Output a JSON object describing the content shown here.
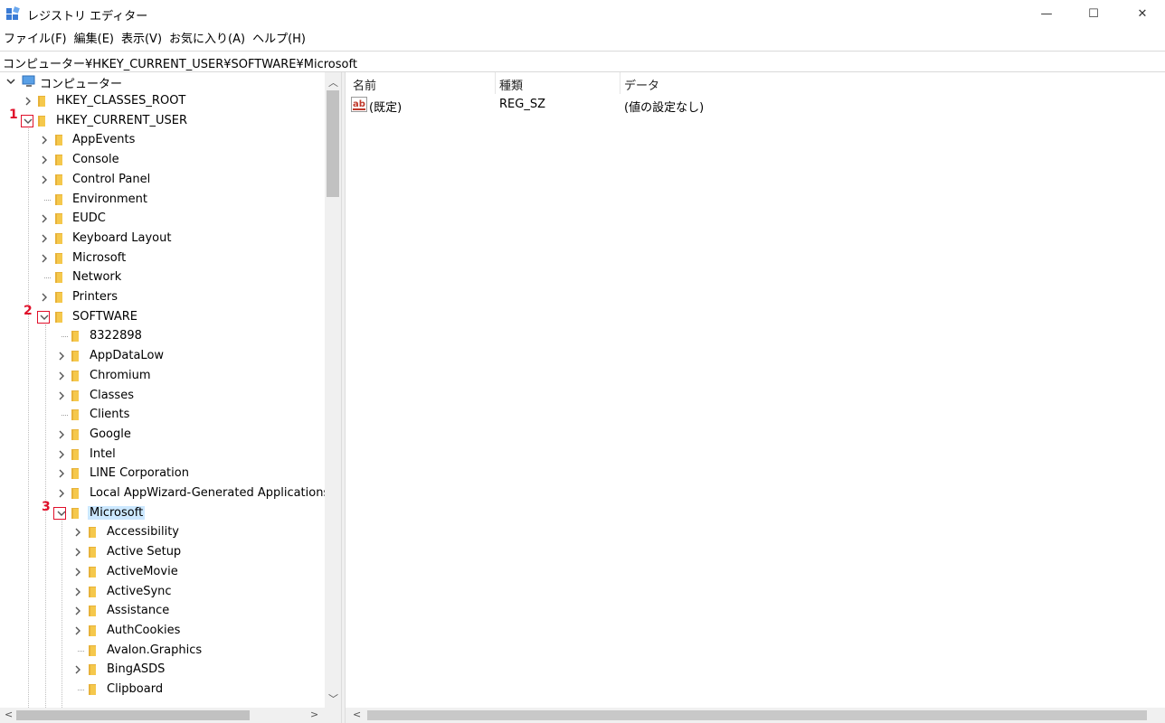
{
  "window": {
    "title": "レジストリ エディター",
    "controls": {
      "minimize": "—",
      "maximize": "☐",
      "close": "✕"
    }
  },
  "menu": [
    "ファイル(F)",
    "編集(E)",
    "表示(V)",
    "お気に入り(A)",
    "ヘルプ(H)"
  ],
  "address": "コンピューター¥HKEY_CURRENT_USER¥SOFTWARE¥Microsoft",
  "tree": {
    "root": "コンピューター",
    "items": [
      {
        "label": "HKEY_CLASSES_ROOT",
        "depth": 1,
        "state": "collapsed"
      },
      {
        "label": "HKEY_CURRENT_USER",
        "depth": 1,
        "state": "expanded",
        "marker": "1"
      },
      {
        "label": "AppEvents",
        "depth": 2,
        "state": "collapsed"
      },
      {
        "label": "Console",
        "depth": 2,
        "state": "collapsed"
      },
      {
        "label": "Control Panel",
        "depth": 2,
        "state": "collapsed"
      },
      {
        "label": "Environment",
        "depth": 2,
        "state": "leaf"
      },
      {
        "label": "EUDC",
        "depth": 2,
        "state": "collapsed"
      },
      {
        "label": "Keyboard Layout",
        "depth": 2,
        "state": "collapsed"
      },
      {
        "label": "Microsoft",
        "depth": 2,
        "state": "collapsed"
      },
      {
        "label": "Network",
        "depth": 2,
        "state": "leaf"
      },
      {
        "label": "Printers",
        "depth": 2,
        "state": "collapsed"
      },
      {
        "label": "SOFTWARE",
        "depth": 2,
        "state": "expanded",
        "marker": "2"
      },
      {
        "label": "8322898",
        "depth": 3,
        "state": "leaf"
      },
      {
        "label": "AppDataLow",
        "depth": 3,
        "state": "collapsed"
      },
      {
        "label": "Chromium",
        "depth": 3,
        "state": "collapsed"
      },
      {
        "label": "Classes",
        "depth": 3,
        "state": "collapsed"
      },
      {
        "label": "Clients",
        "depth": 3,
        "state": "leaf"
      },
      {
        "label": "Google",
        "depth": 3,
        "state": "collapsed"
      },
      {
        "label": "Intel",
        "depth": 3,
        "state": "collapsed"
      },
      {
        "label": "LINE Corporation",
        "depth": 3,
        "state": "collapsed"
      },
      {
        "label": "Local AppWizard-Generated Applications",
        "depth": 3,
        "state": "collapsed"
      },
      {
        "label": "Microsoft",
        "depth": 3,
        "state": "expanded",
        "marker": "3",
        "selected": true
      },
      {
        "label": "Accessibility",
        "depth": 4,
        "state": "collapsed"
      },
      {
        "label": "Active Setup",
        "depth": 4,
        "state": "collapsed"
      },
      {
        "label": "ActiveMovie",
        "depth": 4,
        "state": "collapsed"
      },
      {
        "label": "ActiveSync",
        "depth": 4,
        "state": "collapsed"
      },
      {
        "label": "Assistance",
        "depth": 4,
        "state": "collapsed"
      },
      {
        "label": "AuthCookies",
        "depth": 4,
        "state": "collapsed"
      },
      {
        "label": "Avalon.Graphics",
        "depth": 4,
        "state": "leaf"
      },
      {
        "label": "BingASDS",
        "depth": 4,
        "state": "collapsed"
      },
      {
        "label": "Clipboard",
        "depth": 4,
        "state": "leaf"
      }
    ]
  },
  "list": {
    "columns": [
      "名前",
      "種類",
      "データ"
    ],
    "rows": [
      {
        "name": "(既定)",
        "type": "REG_SZ",
        "data": "(値の設定なし)",
        "icon": "string-value-icon"
      }
    ]
  },
  "icon_labels": {
    "string_value": "ab"
  },
  "colors": {
    "marker": "#e0102a",
    "selection": "#cce8ff",
    "folder": "#f5c84c"
  }
}
